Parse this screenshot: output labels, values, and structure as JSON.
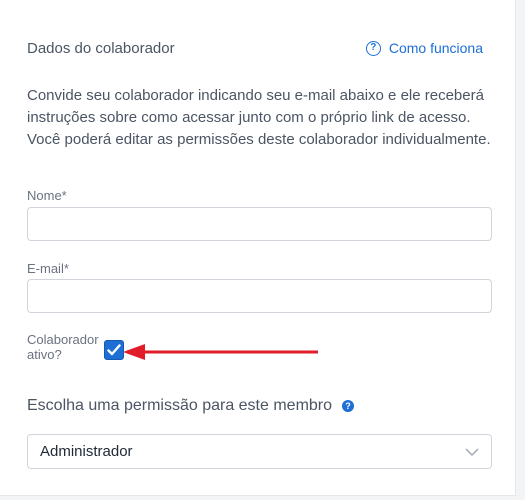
{
  "header": {
    "title": "Dados do colaborador",
    "help_link": "Como funciona"
  },
  "description": "Convide seu colaborador indicando seu e-mail abaixo e ele receberá instruções sobre como acessar junto com o próprio link de acesso. Você poderá editar as permissões deste colaborador individualmente.",
  "form": {
    "name_label": "Nome*",
    "name_value": "",
    "email_label": "E-mail*",
    "email_value": "",
    "active_label": "Colaborador ativo?",
    "active_checked": true,
    "permission_title": "Escolha uma permissão para este membro",
    "permission_selected": "Administrador"
  },
  "colors": {
    "accent": "#1d6fd6",
    "annotation_arrow": "#e11d2a"
  }
}
